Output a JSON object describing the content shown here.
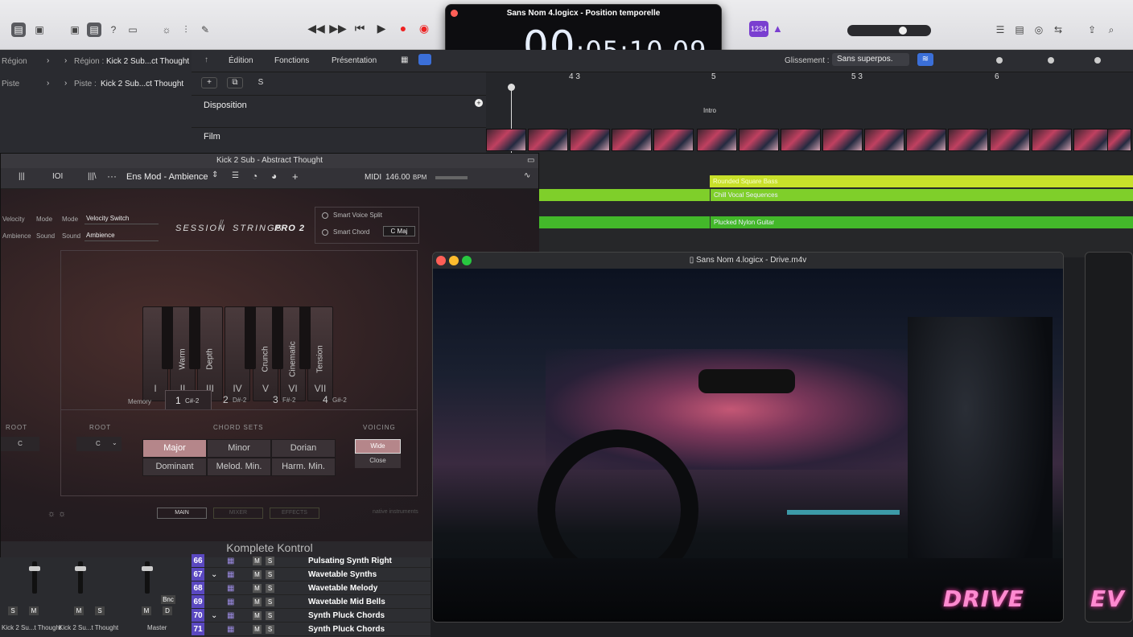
{
  "lcd": {
    "title": "Sans Nom 4.logicx - Position temporelle",
    "time_main": "00",
    "time_rest": ":05:10.09"
  },
  "toolbar": {
    "badge": "1234"
  },
  "info": {
    "region_label": "Région :",
    "region_value": "Kick 2 Sub...ct Thought",
    "track_label": "Piste :",
    "track_value": "Kick 2 Sub...ct Thought",
    "left_region": "Région",
    "left_track": "Piste",
    "left_kick": "Kick"
  },
  "arrange_menu": {
    "edition": "Édition",
    "fonctions": "Fonctions",
    "presentation": "Présentation",
    "glissement_label": "Glissement :",
    "glissement_value": "Sans superpos."
  },
  "ruler": {
    "m1": "4 3",
    "m2": "5",
    "m3": "5 3",
    "m4": "6"
  },
  "tracks_header": {
    "disposition": "Disposition",
    "film": "Film",
    "intro": "Intro"
  },
  "plugin": {
    "title": "Kick 2 Sub - Abstract Thought",
    "preset": "Ens Mod - Ambience",
    "midi": "MIDI",
    "bpm": "146.00",
    "bpm_unit": "BPM",
    "mode_label": "Mode",
    "mode_value": "Velocity Switch",
    "sound_label": "Sound",
    "sound_value": "Ambience",
    "left_mode": "Mode",
    "left_velocity": "Velocity",
    "left_sound": "Sound",
    "left_ambience": "Ambience",
    "brand_session": "SESSION",
    "brand_strings": "STRINGS",
    "brand_pro": "PRO 2",
    "smart_voice": "Smart Voice Split",
    "smart_chord": "Smart Chord",
    "chord_value": "C Maj",
    "memory": "Memory",
    "root": "ROOT",
    "root_value": "C",
    "chord_sets": "CHORD SETS",
    "voicing": "VOICING",
    "wide": "Wide",
    "close": "Close",
    "left_root": "ROOT",
    "left_root_value": "C",
    "tab_main": "MAIN",
    "tab_mixer": "MIXER",
    "tab_effects": "EFFECTS",
    "footer": "Komplete Kontrol",
    "native": "native instruments"
  },
  "keys": [
    {
      "num": "I",
      "lbl": ""
    },
    {
      "num": "II",
      "lbl": "Warm"
    },
    {
      "num": "III",
      "lbl": "Depth"
    },
    {
      "num": "IV",
      "lbl": ""
    },
    {
      "num": "V",
      "lbl": "Crunch"
    },
    {
      "num": "VI",
      "lbl": "Cinematic"
    },
    {
      "num": "VII",
      "lbl": "Tension"
    }
  ],
  "memories": [
    {
      "n": "1",
      "v": "C#-2"
    },
    {
      "n": "2",
      "v": "D#-2"
    },
    {
      "n": "3",
      "v": "F#-2"
    },
    {
      "n": "4",
      "v": "G#-2"
    }
  ],
  "chords": [
    "Major",
    "Minor",
    "Dorian",
    "Dominant",
    "Melod. Min.",
    "Harm. Min."
  ],
  "regions": [
    "Rounded Square Bass",
    "Chill Vocal Sequences",
    "Plucked Nylon Guitar"
  ],
  "video": {
    "title": "Sans Nom 4.logicx - Drive.m4v",
    "overlay": "DRIVE",
    "overlay2": "EV"
  },
  "tracklist": [
    {
      "n": "66",
      "name": "Pulsating Synth Right"
    },
    {
      "n": "67",
      "name": "Wavetable Synths"
    },
    {
      "n": "68",
      "name": "Wavetable Melody"
    },
    {
      "n": "69",
      "name": "Wavetable Mid Bells"
    },
    {
      "n": "70",
      "name": "Synth Pluck Chords"
    },
    {
      "n": "71",
      "name": "Synth Pluck Chords"
    }
  ],
  "mixer": {
    "ch1": "Kick 2 Su...t Thought",
    "ch2": "Kick 2 Su...t Thought",
    "ch3": "Master",
    "bnc": "Bnc",
    "s": "S",
    "m": "M",
    "d": "D"
  },
  "colors": {
    "region_yellow": "#c8e02a",
    "region_green": "#7fcf2a",
    "track_purple": "#5a48c0",
    "lcd_bg": "#0d0d10"
  }
}
